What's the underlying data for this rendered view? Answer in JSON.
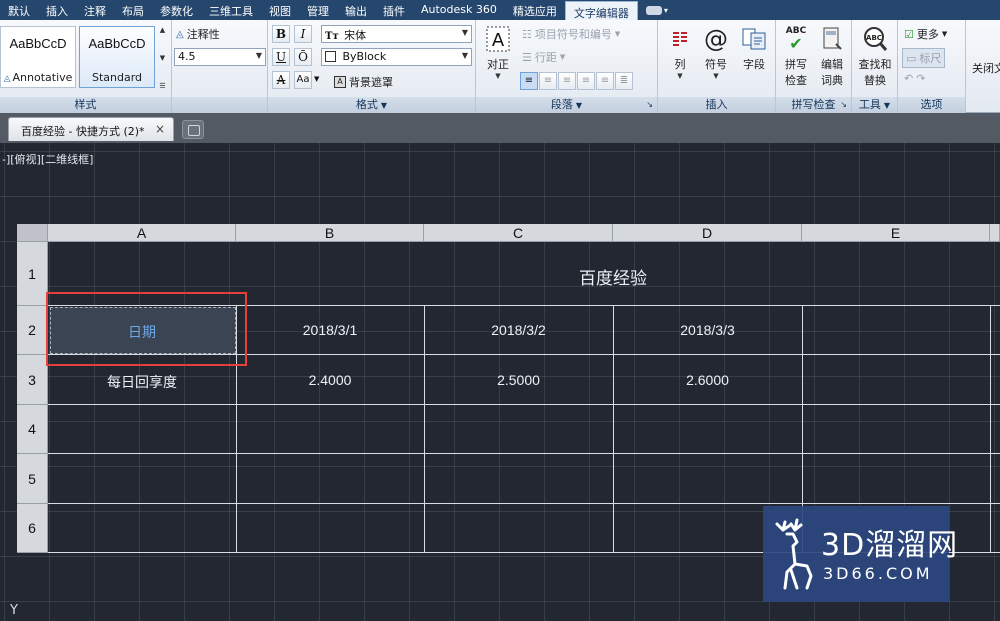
{
  "ribbon_tabs": [
    "默认",
    "插入",
    "注释",
    "布局",
    "参数化",
    "三维工具",
    "视图",
    "管理",
    "输出",
    "插件",
    "Autodesk 360",
    "精选应用",
    "文字编辑器"
  ],
  "active_tab": "文字编辑器",
  "styles_panel": {
    "title": "样式",
    "swatches": [
      {
        "sample": "AaBbCcD",
        "label": "Annotative"
      },
      {
        "sample": "AaBbCcD",
        "label": "Standard"
      }
    ],
    "annotative_label": "注释性",
    "text_height": "4.5"
  },
  "format_panel": {
    "title": "格式",
    "bold": "B",
    "italic": "I",
    "underline": "U",
    "overline": "Ō",
    "strike": "A",
    "case": "Aa",
    "font": "宋体",
    "color": "ByBlock",
    "background_mask": "背景遮罩"
  },
  "paragraph_panel": {
    "title": "段落",
    "justify": "对正",
    "bullets": "项目符号和编号",
    "line_spacing": "行距"
  },
  "insert_panel": {
    "title": "插入",
    "columns": "列",
    "symbol": "符号",
    "field": "字段"
  },
  "spell_panel": {
    "title": "拼写检查",
    "spell_check": [
      "拼写",
      "检查"
    ],
    "edit_dictionary": [
      "编辑",
      "词典"
    ],
    "abc": "ABC"
  },
  "tools_panel": {
    "title": "工具",
    "find_replace": [
      "查找和",
      "替换"
    ],
    "abc": "ABC"
  },
  "options_panel": {
    "title": "选项",
    "more": "更多",
    "ruler": "标尺"
  },
  "close_panel": {
    "label": "关闭文"
  },
  "document_tab": {
    "label": "百度经验 - 快捷方式 (2)*",
    "close": "×"
  },
  "viewport_label": "-][俯视][二维线框]",
  "table": {
    "columns": [
      "A",
      "B",
      "C",
      "D",
      "E"
    ],
    "rows": [
      "1",
      "2",
      "3",
      "4",
      "5",
      "6"
    ],
    "title": "百度经验",
    "row2": [
      "日期",
      "2018/3/1",
      "2018/3/2",
      "2018/3/3",
      ""
    ],
    "row3": [
      "每日回享度",
      "2.4000",
      "2.5000",
      "2.6000",
      ""
    ]
  },
  "ucs_label": "Y",
  "watermark": {
    "brand": "3D溜溜网",
    "site": "3D66.COM"
  },
  "colors": {
    "ribbon_tab_bg": "#25476e",
    "canvas_bg": "#222731",
    "selection_highlight": "#e5403b",
    "selected_text": "#6fa8e8",
    "watermark_bg": "#2d4880"
  }
}
